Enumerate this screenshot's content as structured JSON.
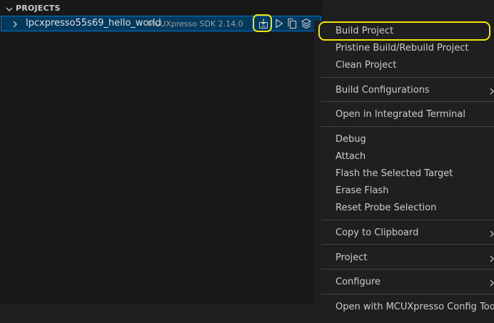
{
  "sidebar": {
    "section_title": "PROJECTS",
    "project": {
      "name": "lpcxpresso55s69_hello_world",
      "sdk": "MCUXpresso SDK 2.14.0"
    },
    "actions": [
      "import-build-icon",
      "run-icon",
      "copy-icon",
      "layers-icon"
    ]
  },
  "menu": {
    "items": [
      {
        "label": "Build Project"
      },
      {
        "label": "Pristine Build/Rebuild Project"
      },
      {
        "label": "Clean Project"
      },
      {
        "label": "Build Configurations"
      },
      {
        "label": "Open in Integrated Terminal"
      },
      {
        "label": "Debug"
      },
      {
        "label": "Attach"
      },
      {
        "label": "Flash the Selected Target"
      },
      {
        "label": "Erase Flash"
      },
      {
        "label": "Reset Probe Selection"
      },
      {
        "label": "Copy to Clipboard"
      },
      {
        "label": "Project"
      },
      {
        "label": "Configure"
      },
      {
        "label": "Open with MCUXpresso Config Tools"
      }
    ]
  },
  "colors": {
    "highlight": "#f5e30c",
    "selection_bg": "#04395e",
    "selection_border": "#0078d4"
  }
}
